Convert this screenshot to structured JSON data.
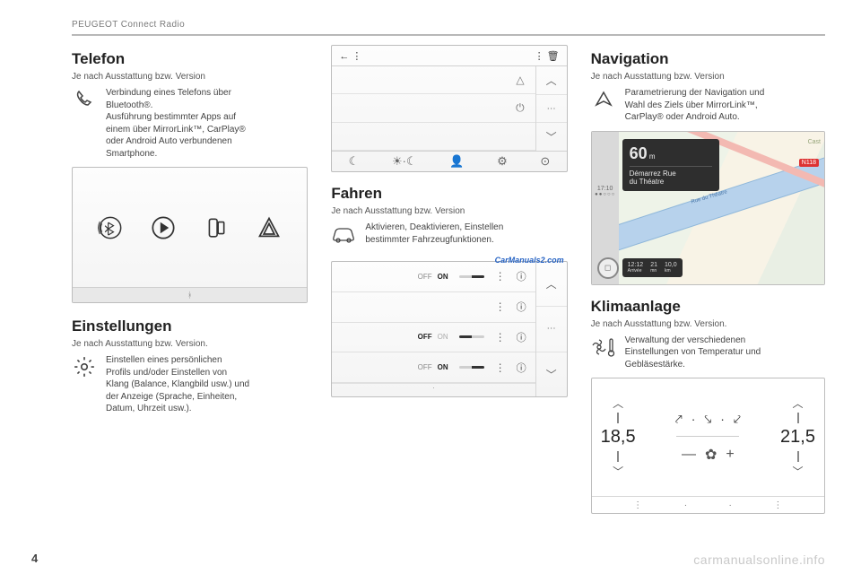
{
  "header": "PEUGEOT Connect Radio",
  "page_number": "4",
  "watermark": "carmanualsonline.info",
  "col1": {
    "section1": {
      "title": "Telefon",
      "subtitle": "Je nach Ausstattung bzw. Version",
      "desc_html": "Verbindung eines Telefons über Bluetooth®.\nAusführung bestimmter Apps auf einem über MirrorLink™, CarPlay® oder Android Auto verbundenen Smartphone.",
      "desc_l1": "Verbindung eines Telefons über",
      "desc_l2": "Bluetooth®.",
      "desc_l3": "Ausführung bestimmter Apps auf",
      "desc_l4": "einem über MirrorLink™, CarPlay®",
      "desc_l5": "oder Android Auto verbundenen",
      "desc_l6": "Smartphone."
    },
    "section2": {
      "title": "Einstellungen",
      "subtitle": "Je nach Ausstattung bzw. Version.",
      "desc_l1": "Einstellen eines persönlichen",
      "desc_l2": "Profils und/oder Einstellen von",
      "desc_l3": "Klang (Balance, Klangbild usw.) und",
      "desc_l4": "der Anzeige (Sprache, Einheiten,",
      "desc_l5": "Datum, Uhrzeit usw.)."
    }
  },
  "col2": {
    "section1": {
      "title": "Fahren",
      "subtitle": "Je nach Ausstattung bzw. Version",
      "desc_l1": "Aktivieren, Deaktivieren, Einstellen",
      "desc_l2": "bestimmter Fahrzeugfunktionen."
    },
    "carmanuals": "CarManuals2.com",
    "toggles": {
      "off": "OFF",
      "on": "ON"
    }
  },
  "col3": {
    "section1": {
      "title": "Navigation",
      "subtitle": "Je nach Ausstattung bzw. Version",
      "desc_l1": "Parametrierung der Navigation und",
      "desc_l2": "Wahl des Ziels über MirrorLink™,",
      "desc_l3": "CarPlay® oder Android Auto."
    },
    "nav": {
      "dist_num": "60",
      "dist_unit": "m",
      "instr_l1": "Démarrez Rue",
      "instr_l2": "du Théatre",
      "time": "17:10",
      "eta_time": "12:12",
      "eta_time_lbl": "Arrivée",
      "eta_min": "21",
      "eta_min_lbl": "mn",
      "eta_dist": "10,0",
      "eta_dist_lbl": "km",
      "road_label": "Rue du Théatre",
      "badge": "N118",
      "place": "Cast"
    },
    "section2": {
      "title": "Klimaanlage",
      "subtitle": "Je nach Ausstattung bzw. Version.",
      "desc_l1": "Verwaltung der verschiedenen",
      "desc_l2": "Einstellungen von Temperatur und",
      "desc_l3": "Gebläsestärke."
    },
    "climate": {
      "temp_left": "18,5",
      "temp_right": "21,5"
    }
  }
}
